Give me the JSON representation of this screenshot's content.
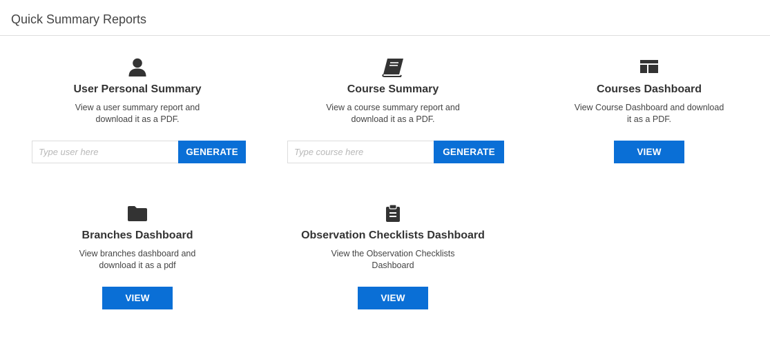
{
  "header": {
    "title": "Quick Summary Reports"
  },
  "cards": [
    {
      "icon": "user-icon",
      "title": "User Personal Summary",
      "description": "View a user summary report and download it as a PDF.",
      "input_placeholder": "Type user here",
      "button_label": "GENERATE"
    },
    {
      "icon": "book-icon",
      "title": "Course Summary",
      "description": "View a course summary report and download it as a PDF.",
      "input_placeholder": "Type course here",
      "button_label": "GENERATE"
    },
    {
      "icon": "dashboard-layout-icon",
      "title": "Courses Dashboard",
      "description": "View Course Dashboard and download it as a PDF.",
      "button_label": "VIEW"
    },
    {
      "icon": "folder-icon",
      "title": "Branches Dashboard",
      "description": "View branches dashboard and download it as a pdf",
      "button_label": "VIEW"
    },
    {
      "icon": "clipboard-icon",
      "title": "Observation Checklists Dashboard",
      "description": "View the Observation Checklists Dashboard",
      "button_label": "VIEW"
    }
  ],
  "colors": {
    "button_bg": "#0a6fd6",
    "icon": "#333333",
    "divider": "#dddddd"
  }
}
